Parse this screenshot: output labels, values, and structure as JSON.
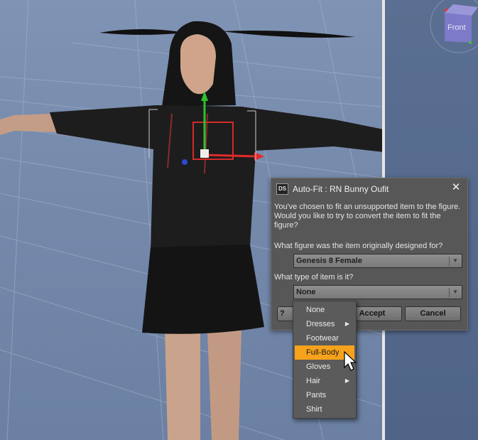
{
  "dialog": {
    "icon_label": "DS",
    "title": "Auto-Fit : RN Bunny Oufit",
    "close_glyph": "✕",
    "message_line1": "You've chosen to fit an unsupported item to the figure.",
    "message_line2": "Would you like to try to convert the item to fit the figure?",
    "question_figure": "What figure was the item originally designed for?",
    "figure_selected": "Genesis 8 Female",
    "question_type": "What type of item is it?",
    "type_selected": "None",
    "help_label": "?",
    "accept_label": "Accept",
    "cancel_label": "Cancel"
  },
  "dropdown": {
    "items": [
      {
        "label": "None",
        "submenu": false
      },
      {
        "label": "Dresses",
        "submenu": true
      },
      {
        "label": "Footwear",
        "submenu": false
      },
      {
        "label": "Full-Body",
        "submenu": false,
        "highlighted": true
      },
      {
        "label": "Gloves",
        "submenu": false
      },
      {
        "label": "Hair",
        "submenu": true
      },
      {
        "label": "Pants",
        "submenu": false
      },
      {
        "label": "Shirt",
        "submenu": false
      }
    ],
    "submenu_glyph": "▶"
  },
  "view_cube": {
    "label": "Front"
  },
  "colors": {
    "accent_highlight": "#f7a21c",
    "dialog_bg": "#575757",
    "viewport_bg": "#7589ab"
  }
}
